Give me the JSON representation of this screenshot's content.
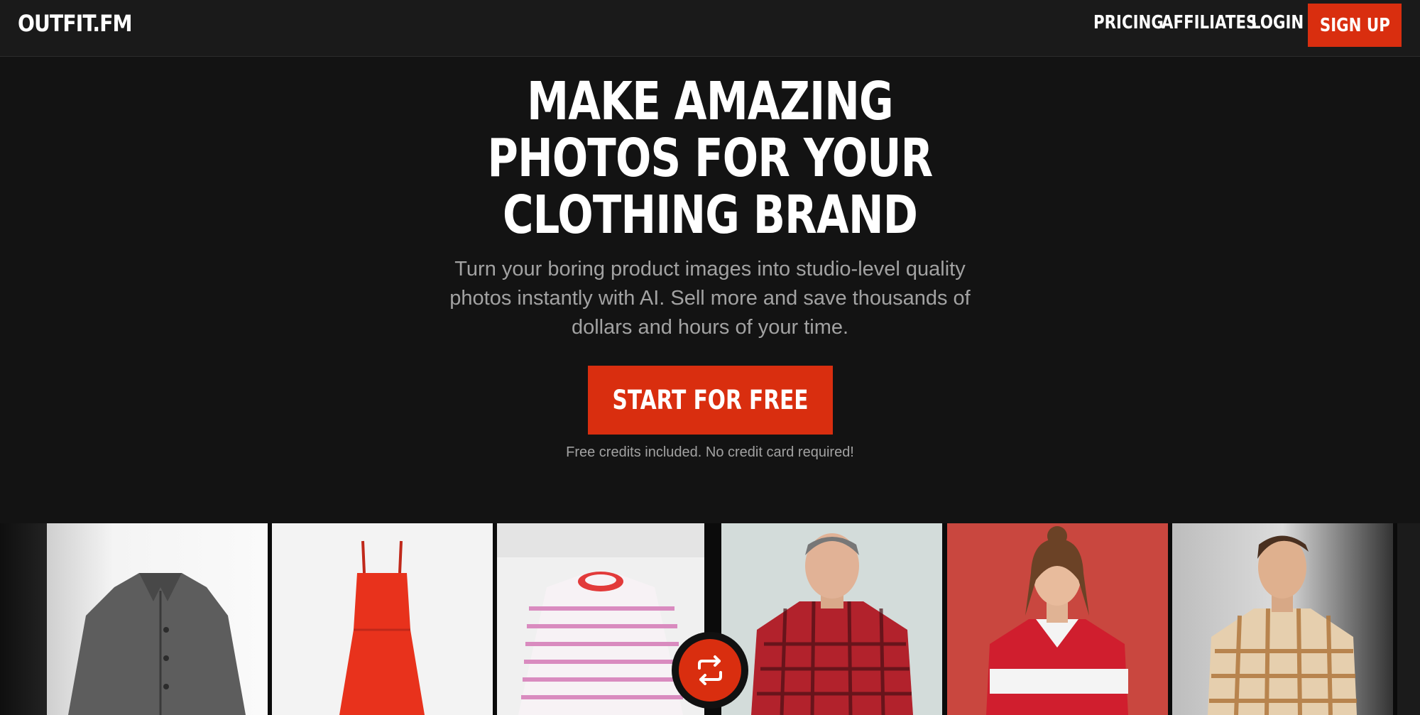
{
  "brand": {
    "logo": "OUTFIT.FM",
    "accent_color": "#d92e0f"
  },
  "nav": {
    "pricing": "PRICING",
    "affiliates": "AFFILIATES",
    "login": "LOGIN",
    "signup": "SIGN UP"
  },
  "hero": {
    "headline_lines": [
      "MAKE AMAZING",
      "PHOTOS FOR YOUR",
      "CLOTHING BRAND"
    ],
    "subtitle": "Turn your boring product images into studio-level quality photos instantly with AI. Sell more and save thousands of dollars and hours of your time.",
    "cta": "START FOR FREE",
    "note": "Free credits included. No credit card required!"
  },
  "gallery": {
    "before": [
      {
        "item": "grey wool jacket",
        "bg_color": "#ececec"
      },
      {
        "item": "red strappy dress",
        "bg_color": "#f3f3f3"
      },
      {
        "item": "pink striped long-sleeve tee",
        "bg_color": "#f1f1f1"
      }
    ],
    "after": [
      {
        "item": "man in red plaid shirt",
        "bg_color": "#cfd9d7"
      },
      {
        "item": "woman in red and white polo",
        "bg_color": "#c9463f"
      },
      {
        "item": "man in tan plaid shirt",
        "bg_color": "#d4d4d4"
      }
    ],
    "swap_icon": "swap-arrows-icon"
  }
}
